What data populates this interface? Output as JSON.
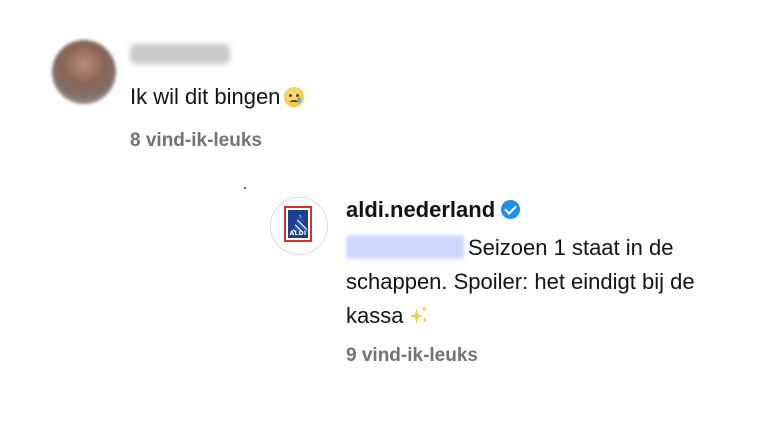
{
  "comments": [
    {
      "text": "Ik wil dit bingen",
      "emoji": "crying-face-emoji",
      "likes": "8 vind-ik-leuks"
    },
    {
      "author": "aldi.nederland",
      "verified": true,
      "text_main": "Seizoen 1 staat in de schappen. Spoiler: het eindigt bij de kassa",
      "emoji": "sparkles-emoji",
      "likes": "9 vind-ik-leuks",
      "logo_text": "ALDI"
    }
  ],
  "colors": {
    "likes_gray": "#737373",
    "verified_blue": "#1f8fe6",
    "aldi_blue": "#1e3f8f",
    "aldi_red": "#d6322c"
  }
}
